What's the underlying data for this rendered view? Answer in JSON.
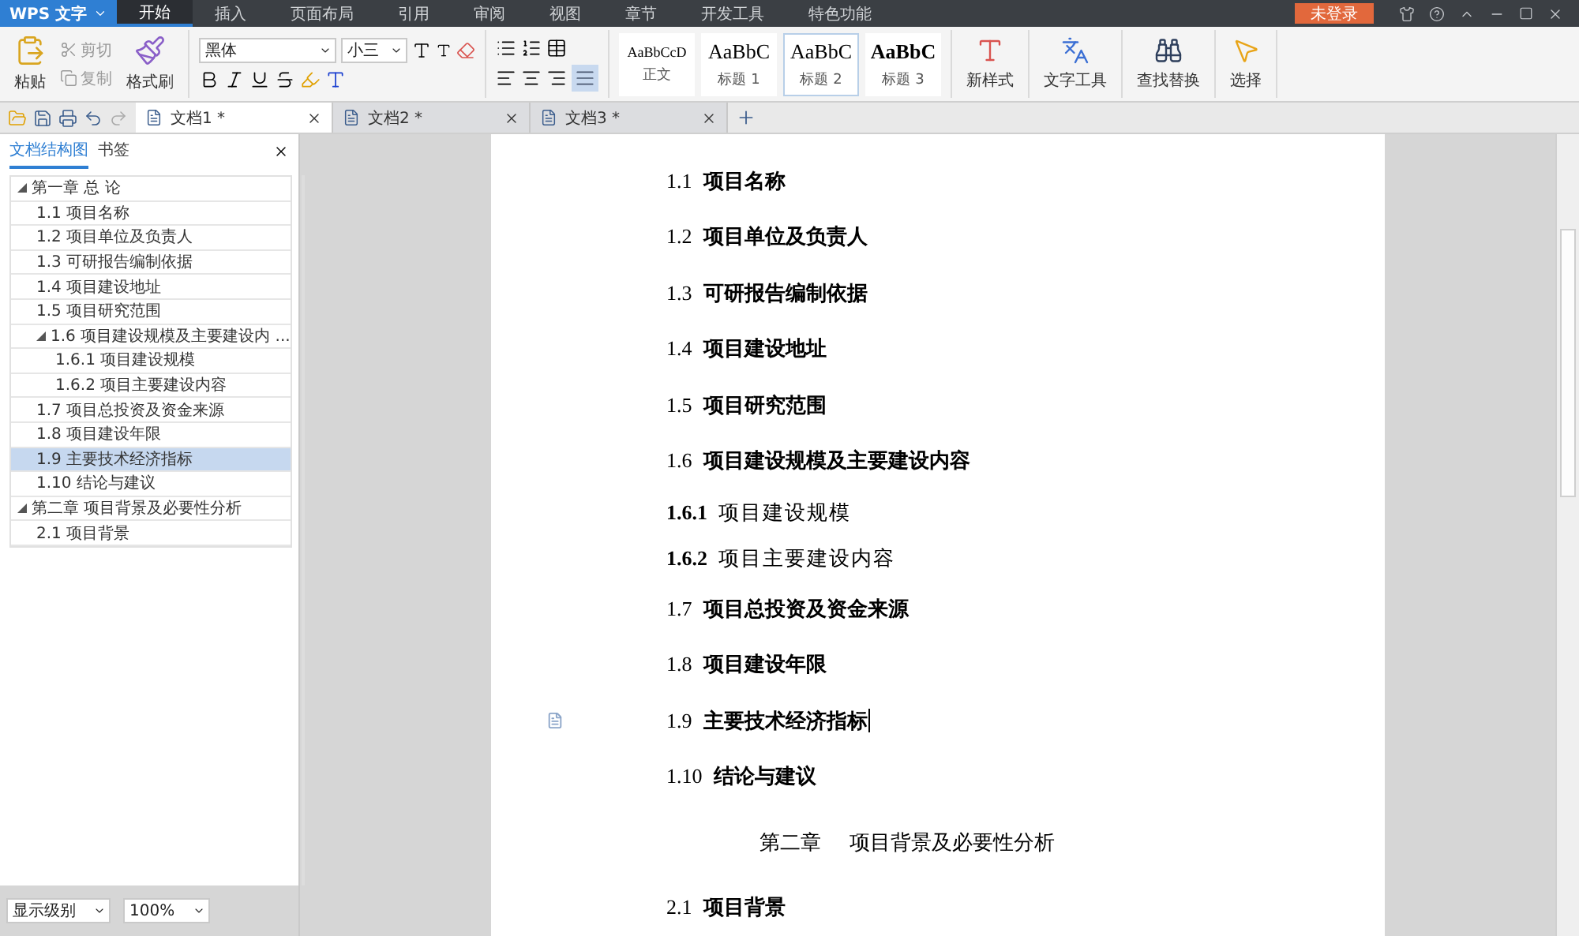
{
  "app": {
    "name": "WPS 文字"
  },
  "menu_tabs": [
    {
      "label": "开始",
      "selected": true
    },
    {
      "label": "插入",
      "selected": false
    },
    {
      "label": "页面布局",
      "selected": false
    },
    {
      "label": "引用",
      "selected": false
    },
    {
      "label": "审阅",
      "selected": false
    },
    {
      "label": "视图",
      "selected": false
    },
    {
      "label": "章节",
      "selected": false
    },
    {
      "label": "开发工具",
      "selected": false
    },
    {
      "label": "特色功能",
      "selected": false
    }
  ],
  "login_button": "未登录",
  "clipboard": {
    "paste": "粘贴",
    "cut": "剪切",
    "copy": "复制",
    "format_painter": "格式刷"
  },
  "font": {
    "name": "黑体",
    "size": "小三"
  },
  "styles": [
    {
      "preview": "AaBbCcD",
      "label": "正文",
      "selected": false
    },
    {
      "preview": "AaBbC",
      "label": "标题 1",
      "selected": false
    },
    {
      "preview": "AaBbC",
      "label": "标题 2",
      "selected": true
    },
    {
      "preview": "AaBbC",
      "label": "标题 3",
      "selected": false
    }
  ],
  "tools": [
    {
      "kind": "new-style",
      "label": "新样式"
    },
    {
      "kind": "text-tools",
      "label": "文字工具"
    },
    {
      "kind": "find",
      "label": "查找替换"
    },
    {
      "kind": "select",
      "label": "选择"
    }
  ],
  "doc_tabs": [
    {
      "label": "文档1 *",
      "selected": true
    },
    {
      "label": "文档2 *",
      "selected": false
    },
    {
      "label": "文档3 *",
      "selected": false
    }
  ],
  "sidebar": {
    "tabs": [
      {
        "label": "文档结构图",
        "selected": true
      },
      {
        "label": "书签",
        "selected": false
      }
    ],
    "outline": [
      {
        "label": "第一章   总  论",
        "expanded": true,
        "selected": false,
        "children": [
          {
            "label": "1.1  项目名称",
            "selected": false
          },
          {
            "label": "1.2  项目单位及负责人",
            "selected": false
          },
          {
            "label": "1.3  可研报告编制依据",
            "selected": false
          },
          {
            "label": "1.4  项目建设地址",
            "selected": false
          },
          {
            "label": "1.5  项目研究范围",
            "selected": false
          },
          {
            "label": "1.6  项目建设规模及主要建设内 ...",
            "expanded": true,
            "selected": false,
            "children": [
              {
                "label": "1.6.1  项目建设规模",
                "selected": false
              },
              {
                "label": "1.6.2  项目主要建设内容",
                "selected": false
              }
            ]
          },
          {
            "label": "1.7  项目总投资及资金来源",
            "selected": false
          },
          {
            "label": "1.8  项目建设年限",
            "selected": false
          },
          {
            "label": "1.9  主要技术经济指标",
            "selected": true
          },
          {
            "label": "1.10  结论与建议",
            "selected": false
          }
        ]
      },
      {
        "label": "第二章    项目背景及必要性分析",
        "expanded": true,
        "selected": false,
        "children": [
          {
            "label": "2.1  项目背景",
            "selected": false
          }
        ]
      }
    ],
    "level_select": "显示级别",
    "zoom": "100%"
  },
  "document": {
    "paragraphs": [
      {
        "kind": "heading2",
        "number": "1.1",
        "text": "项目名称",
        "caret": false
      },
      {
        "kind": "heading2",
        "number": "1.2",
        "text": "项目单位及负责人",
        "caret": false
      },
      {
        "kind": "heading2",
        "number": "1.3",
        "text": "可研报告编制依据",
        "caret": false
      },
      {
        "kind": "heading2",
        "number": "1.4",
        "text": "项目建设地址",
        "caret": false
      },
      {
        "kind": "heading2",
        "number": "1.5",
        "text": "项目研究范围",
        "caret": false
      },
      {
        "kind": "heading2",
        "number": "1.6",
        "text": "项目建设规模及主要建设内容",
        "caret": false
      },
      {
        "kind": "heading3",
        "number": "1.6.1",
        "text": "项目建设规模",
        "caret": false
      },
      {
        "kind": "heading3",
        "number": "1.6.2",
        "text": "项目主要建设内容",
        "caret": false
      },
      {
        "kind": "heading2",
        "number": "1.7",
        "text": "项目总投资及资金来源",
        "caret": false
      },
      {
        "kind": "heading2",
        "number": "1.8",
        "text": "项目建设年限",
        "caret": false
      },
      {
        "kind": "heading2",
        "number": "1.9",
        "text": "主要技术经济指标",
        "caret": true
      },
      {
        "kind": "heading2",
        "number": "1.10",
        "text": "结论与建议",
        "caret": false
      },
      {
        "kind": "chapter",
        "number": "第二章",
        "text": "项目背景及必要性分析",
        "caret": false
      },
      {
        "kind": "heading2",
        "number": "2.1",
        "text": "项目背景",
        "caret": false
      }
    ]
  }
}
